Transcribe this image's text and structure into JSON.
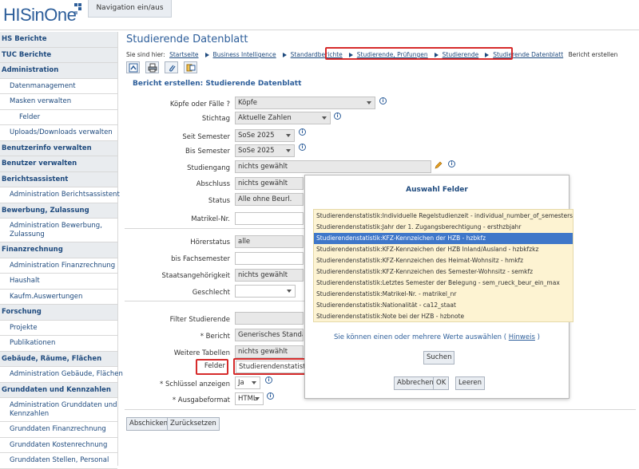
{
  "app": {
    "logo_text": "HISinOne",
    "nav_toggle_label": "Navigation ein/aus"
  },
  "sidebar": {
    "items": [
      {
        "label": "HS Berichte",
        "type": "cat"
      },
      {
        "label": "TUC Berichte",
        "type": "cat"
      },
      {
        "label": "Administration",
        "type": "cat"
      },
      {
        "label": "Datenmanagement",
        "type": "sub"
      },
      {
        "label": "Masken verwalten",
        "type": "sub"
      },
      {
        "label": "Felder",
        "type": "sub2"
      },
      {
        "label": "Uploads/Downloads verwalten",
        "type": "sub"
      },
      {
        "label": "Benutzerinfo verwalten",
        "type": "cat"
      },
      {
        "label": "Benutzer verwalten",
        "type": "cat"
      },
      {
        "label": "Berichtsassistent",
        "type": "cat"
      },
      {
        "label": "Administration Berichtsassistent",
        "type": "sub"
      },
      {
        "label": "Bewerbung, Zulassung",
        "type": "cat"
      },
      {
        "label": "Administration Bewerbung, Zulassung",
        "type": "sub two"
      },
      {
        "label": "Finanzrechnung",
        "type": "cat"
      },
      {
        "label": "Administration Finanzrechnung",
        "type": "sub"
      },
      {
        "label": "Haushalt",
        "type": "sub"
      },
      {
        "label": "Kaufm.Auswertungen",
        "type": "sub"
      },
      {
        "label": "Forschung",
        "type": "cat"
      },
      {
        "label": "Projekte",
        "type": "sub"
      },
      {
        "label": "Publikationen",
        "type": "sub"
      },
      {
        "label": "Gebäude, Räume, Flächen",
        "type": "cat"
      },
      {
        "label": "Administration Gebäude, Flächen",
        "type": "sub"
      },
      {
        "label": "Grunddaten und Kennzahlen",
        "type": "cat"
      },
      {
        "label": "Administration Grunddaten und Kennzahlen",
        "type": "sub two"
      },
      {
        "label": "Grunddaten Finanzrechnung",
        "type": "sub"
      },
      {
        "label": "Grunddaten Kostenrechnung",
        "type": "sub"
      },
      {
        "label": "Grunddaten Stellen, Personal",
        "type": "sub"
      }
    ]
  },
  "main": {
    "page_title": "Studierende Datenblatt",
    "breadcrumb": {
      "prefix": "Sie sind hier:",
      "items": [
        "Startseite",
        "Business Intelligence",
        "Standardberichte",
        "Studierende, Prüfungen",
        "Studierende",
        "Studierende Datenblatt"
      ],
      "current": "Bericht erstellen"
    },
    "toolbar": [
      "report-icon",
      "print-icon",
      "attach-icon",
      "export-icon"
    ],
    "form_title": "Bericht erstellen: Studierende Datenblatt",
    "form": {
      "koepfe_label": "Köpfe oder Fälle ?",
      "koepfe_value": "Köpfe",
      "stichtag_label": "Stichtag",
      "stichtag_value": "Aktuelle Zahlen",
      "seit_label": "Seit Semester",
      "seit_value": "SoSe 2025",
      "bis_label": "Bis Semester",
      "bis_value": "SoSe 2025",
      "studiengang_label": "Studiengang",
      "studiengang_value": "nichts gewählt",
      "abschluss_label": "Abschluss",
      "abschluss_value": "nichts gewählt",
      "status_label": "Status",
      "status_value": "Alle ohne Beurl.",
      "matrikel_label": "Matrikel-Nr.",
      "matrikel_value": "",
      "hoererstatus_label": "Hörerstatus",
      "hoererstatus_value": "alle",
      "bis_fachsemester_label": "bis Fachsemester",
      "bis_fachsemester_value": "",
      "staatsangehoerigkeit_label": "Staatsangehörigkeit",
      "staatsangehoerigkeit_value": "nichts gewählt",
      "geschlecht_label": "Geschlecht",
      "geschlecht_value": "",
      "filter_label": "Filter Studierende",
      "filter_value": "",
      "bericht_label": "* Bericht",
      "bericht_value": "Generisches Standard",
      "weitere_label": "Weitere Tabellen",
      "weitere_value": "nichts gewählt",
      "felder_label": "Felder",
      "felder_value": "Studierendenstatistik:",
      "schluessel_label": "* Schlüssel anzeigen",
      "schluessel_value": "Ja",
      "ausgabe_label": "* Ausgabeformat",
      "ausgabe_value": "HTML"
    },
    "buttons": {
      "abschicken": "Abschicken",
      "zuruecksetzen": "Zurücksetzen"
    }
  },
  "popup": {
    "title": "Auswahl Felder",
    "options": [
      "Studierendenstatistik:Individuelle Regelstudienzeit - individual_number_of_semesters",
      "Studierendenstatistik:Jahr der 1. Zugangsberechtigung - ersthzbjahr",
      "Studierendenstatistik:KFZ-Kennzeichen der HZB - hzbkfz",
      "Studierendenstatistik:KFZ-Kennzeichen der HZB Inland/Ausland - hzbkfzkz",
      "Studierendenstatistik:KFZ-Kennzeichen des Heimat-Wohnsitz - hmkfz",
      "Studierendenstatistik:KFZ-Kennzeichen des Semester-Wohnsitz - semkfz",
      "Studierendenstatistik:Letztes Semester der Belegung - sem_rueck_beur_ein_max",
      "Studierendenstatistik:Matrikel-Nr. - matrikel_nr",
      "Studierendenstatistik:Nationalität - ca12_staat",
      "Studierendenstatistik:Note bei der HZB - hzbnote"
    ],
    "selected_index": 2,
    "hint_prefix": "Sie können einen oder mehrere Werte auswählen (",
    "hint_link": "Hinweis",
    "hint_suffix": ")",
    "suchen": "Suchen",
    "abbrechen": "Abbrechen",
    "ok": "OK",
    "leeren": "Leeren"
  },
  "colors": {
    "brand": "#2d5e9a",
    "highlight_red": "#d62b2b",
    "selection": "#3f77c9",
    "list_bg": "#fdf3d2"
  }
}
